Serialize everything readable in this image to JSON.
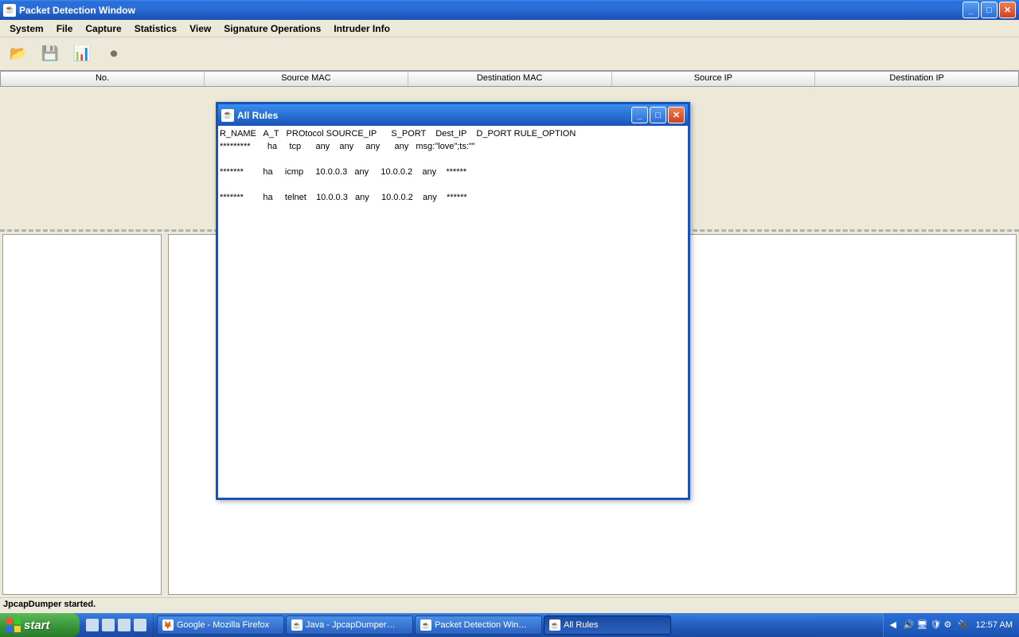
{
  "main_window": {
    "title": "Packet Detection Window"
  },
  "menu": {
    "items": [
      "System",
      "File",
      "Capture",
      "Statistics",
      "View",
      "Signature Operations",
      "Intruder Info"
    ]
  },
  "toolbar": {
    "open_icon": "📂",
    "save_icon": "💾",
    "capture_icon": "📊",
    "stop_icon": "⏺"
  },
  "table": {
    "columns": [
      "No.",
      "Source MAC",
      "Destination MAC",
      "Source IP",
      "Destination IP"
    ]
  },
  "statusbar": {
    "text": "JpcapDumper started."
  },
  "dialog": {
    "title": "All Rules",
    "header": "R_NAME   A_T   PROtocol SOURCE_IP      S_PORT    Dest_IP    D_PORT RULE_OPTION",
    "rows": [
      "*********       ha     tcp      any    any     any      any   msg:\"love\";ts:\"\"",
      "",
      "*******        ha     icmp     10.0.0.3   any     10.0.0.2    any    ******",
      "",
      "*******        ha     telnet    10.0.0.3   any     10.0.0.2    any    ******"
    ]
  },
  "taskbar": {
    "start": "start",
    "items": [
      {
        "label": "Google - Mozilla Firefox",
        "active": false
      },
      {
        "label": "Java - JpcapDumper…",
        "active": false
      },
      {
        "label": "Packet Detection Win…",
        "active": false
      },
      {
        "label": "All Rules",
        "active": true
      }
    ],
    "clock": "12:57 AM"
  }
}
